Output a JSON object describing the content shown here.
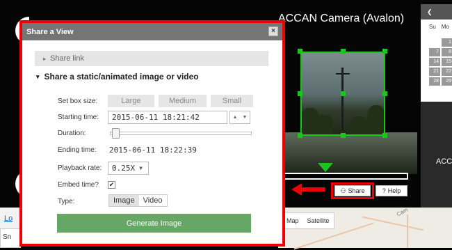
{
  "camera": {
    "title": "ACCAN Camera (Avalon)",
    "secondary_label": "ACC"
  },
  "left_strip": {
    "link": "Lo",
    "bottom": "Sn"
  },
  "calendar": {
    "weekdays": [
      "Su",
      "Mo"
    ],
    "days": [
      "1",
      "7",
      "8",
      "14",
      "15",
      "21",
      "22",
      "28",
      "29"
    ]
  },
  "player": {
    "share_label": "Share",
    "help_label": "Help"
  },
  "map": {
    "tabs": [
      "Map",
      "Satellite"
    ],
    "road_label": "Cam"
  },
  "dialog": {
    "title": "Share a View",
    "close_label": "×",
    "section_collapsed": "Share link",
    "section_expanded": "Share a static/animated image or video",
    "box_size_label": "Set box size:",
    "box_sizes": [
      "Large",
      "Medium",
      "Small"
    ],
    "starting_time_label": "Starting time:",
    "starting_time_value": "2015-06-11 18:21:42",
    "duration_label": "Duration:",
    "duration_level": 0.03,
    "ending_time_label": "Ending time:",
    "ending_time_value": "2015-06-11 18:22:39",
    "playback_rate_label": "Playback rate:",
    "playback_rate_value": "0.25X",
    "embed_time_label": "Embed time?",
    "embed_time_checked": true,
    "type_label": "Type:",
    "types": [
      "Image",
      "Video"
    ],
    "selected_type": "Image",
    "generate_button": "Generate Image"
  },
  "colors": {
    "highlight": "#ee0000",
    "selection": "#1ec41e",
    "generate": "#66a766"
  }
}
